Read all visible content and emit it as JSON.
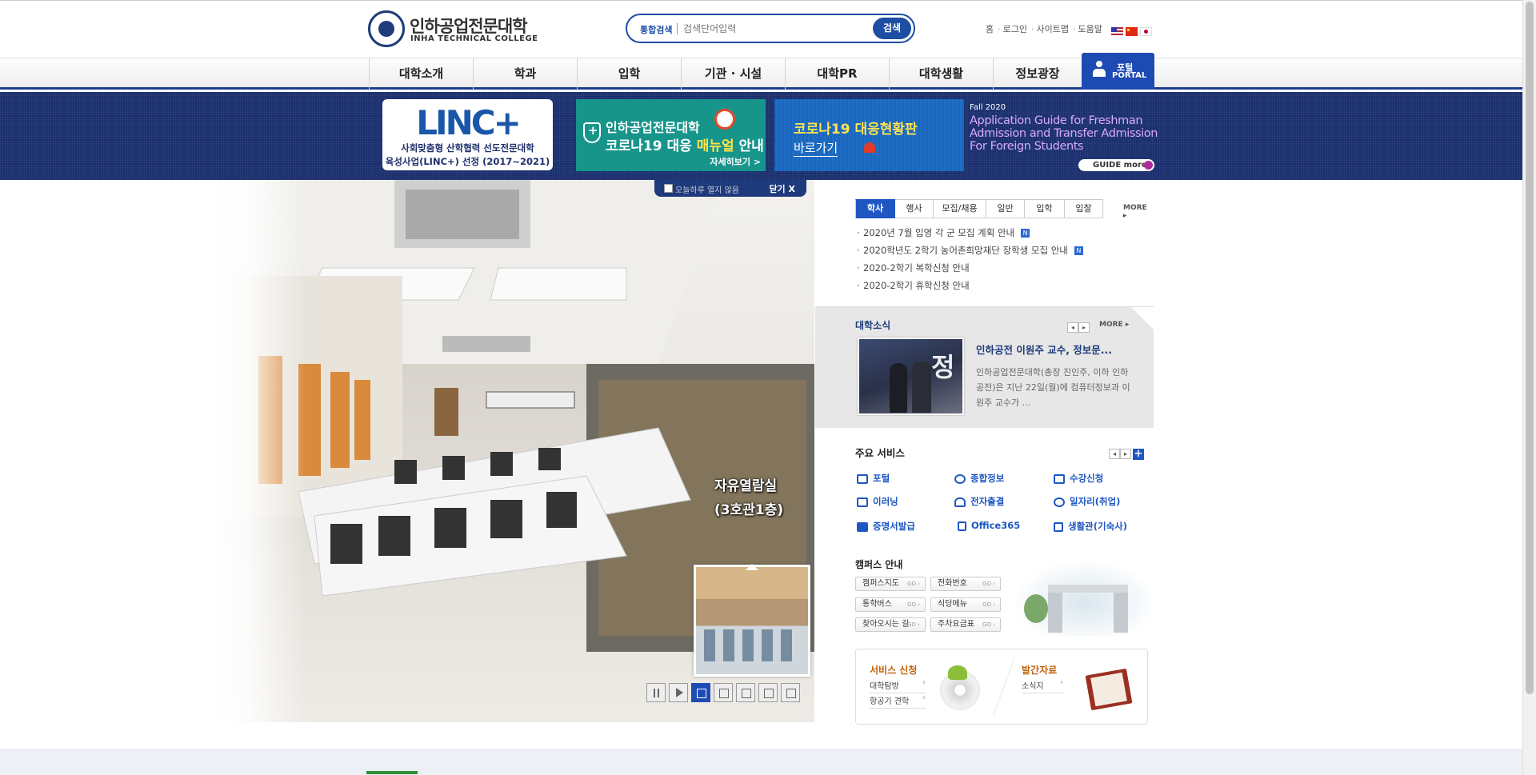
{
  "header": {
    "logo_kr": "인하공업전문대학",
    "logo_en": "INHA TECHNICAL COLLEGE",
    "search": {
      "category": "통합검색",
      "placeholder": "검색단어입력",
      "button": "검색"
    },
    "util_links": [
      "홈",
      "로그인",
      "사이트맵",
      "도움말"
    ],
    "flags": [
      "us-flag-icon",
      "cn-flag-icon",
      "jp-flag-icon"
    ]
  },
  "nav": {
    "items": [
      "대학소개",
      "학과",
      "입학",
      "기관 · 시설",
      "대학PR",
      "대학생활",
      "정보광장"
    ],
    "portal_kr": "포털",
    "portal_en": "PORTAL"
  },
  "banners": {
    "linc": {
      "logo": "LINC+",
      "line1": "사회맞춤형 산학협력 선도전문대학",
      "line2": "육성사업(LINC+) 선정 (2017~2021)"
    },
    "manual": {
      "line1": "인하공업전문대학",
      "line2_a": "코로나19 대응 ",
      "line2_b": "매뉴얼",
      "line2_c": " 안내",
      "more": "자세히보기 >"
    },
    "covid": {
      "line1": "코로나19 대응현황판",
      "line2": "바로가기"
    },
    "guide": {
      "season": "Fall 2020",
      "line1": "Application Guide for Freshman",
      "line2": "Admission and Transfer Admission",
      "line3": "For Foreign Students",
      "button": "GUIDE more"
    }
  },
  "popup": {
    "checkbox_label": "오늘하루 열지 않음",
    "close": "닫기 X"
  },
  "hero": {
    "caption_line1": "자유열람실",
    "caption_line2": "(3호관1층)",
    "active_slide": 1,
    "slide_count": 5
  },
  "notice": {
    "tabs": [
      "학사",
      "행사",
      "모집/채용",
      "일반",
      "입학",
      "입찰"
    ],
    "active_tab": "학사",
    "more": "MORE ▸",
    "items": [
      {
        "title": "2020년 7월 입영 각 군 모집 계획 안내",
        "new": true
      },
      {
        "title": "2020학년도 2학기 농어촌희망재단 장학생 모집 안내",
        "new": true
      },
      {
        "title": "2020-2학기 복학신청 안내",
        "new": false
      },
      {
        "title": "2020-2학기 휴학신청 안내",
        "new": false
      }
    ],
    "new_badge": "N"
  },
  "news": {
    "title": "대학소식",
    "more": "MORE ▸",
    "headline": "인하공전 이원주 교수, 정보문...",
    "body": "인하공업전문대학(총장 진인주, 이하 인하공전)은 지난 22일(월)에 컴퓨터정보과 이원주 교수가 ..."
  },
  "services": {
    "title": "주요 서비스",
    "items": [
      {
        "label": "포털",
        "icon": "monitor-icon"
      },
      {
        "label": "종합정보",
        "icon": "gear-icon"
      },
      {
        "label": "수강신청",
        "icon": "computer-icon"
      },
      {
        "label": "이러닝",
        "icon": "elearning-icon"
      },
      {
        "label": "전자출결",
        "icon": "bell-icon"
      },
      {
        "label": "일자리(취업)",
        "icon": "search-icon"
      },
      {
        "label": "증명서발급",
        "icon": "certificate-icon"
      },
      {
        "label": "Office365",
        "icon": "document-icon"
      },
      {
        "label": "생활관(기숙사)",
        "icon": "building-icon"
      }
    ]
  },
  "campus": {
    "title": "캠퍼스 안내",
    "go": "GO ›",
    "buttons": [
      "캠퍼스지도",
      "전화번호",
      "통학버스",
      "식당메뉴",
      "찾아오시는 길",
      "주차요금표"
    ]
  },
  "service_box": {
    "apply_title": "서비스 신청",
    "apply_links": [
      "대학탐방",
      "항공기 견학"
    ],
    "pub_title": "발간자료",
    "pub_links": [
      "소식지"
    ]
  }
}
